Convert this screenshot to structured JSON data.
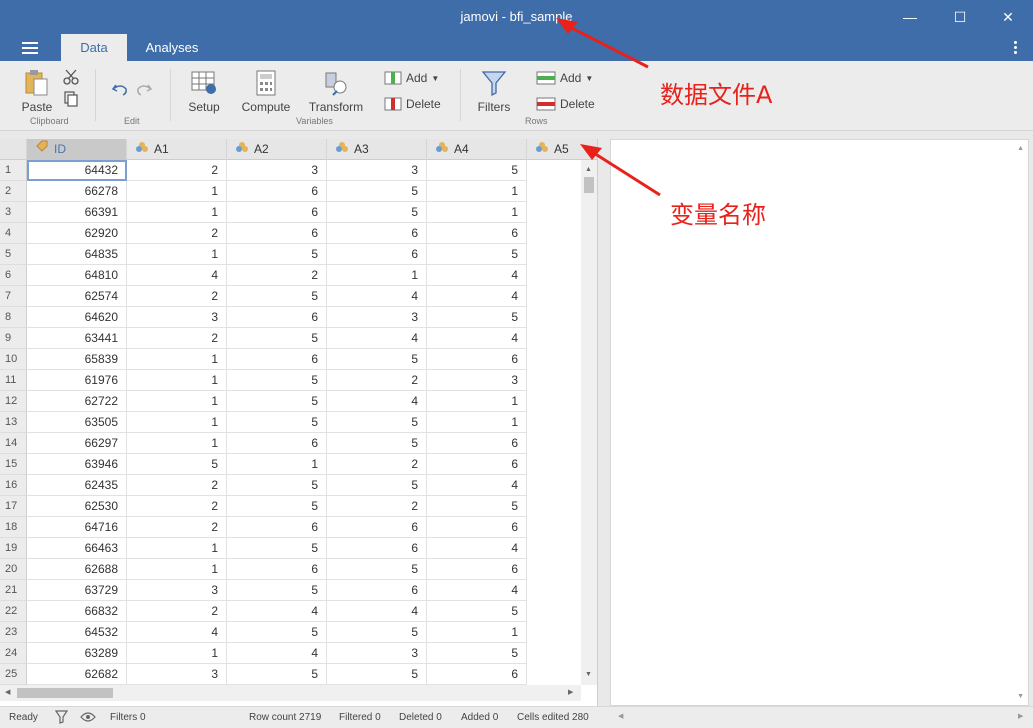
{
  "window": {
    "title": "jamovi - bfi_sample",
    "minimize": "—",
    "maximize": "☐",
    "close": "✕"
  },
  "tabs": {
    "data": "Data",
    "analyses": "Analyses"
  },
  "ribbon": {
    "clipboard": {
      "paste": "Paste",
      "group": "Clipboard"
    },
    "edit": {
      "group": "Edit"
    },
    "variables": {
      "setup": "Setup",
      "compute": "Compute",
      "transform": "Transform",
      "add": "Add",
      "delete": "Delete",
      "group": "Variables"
    },
    "rows": {
      "filters": "Filters",
      "add": "Add",
      "delete": "Delete",
      "group": "Rows"
    }
  },
  "columns": [
    "ID",
    "A1",
    "A2",
    "A3",
    "A4",
    "A5"
  ],
  "rows": [
    [
      1,
      64432,
      2,
      3,
      3,
      5
    ],
    [
      2,
      66278,
      1,
      6,
      5,
      1
    ],
    [
      3,
      66391,
      1,
      6,
      5,
      1
    ],
    [
      4,
      62920,
      2,
      6,
      6,
      6
    ],
    [
      5,
      64835,
      1,
      5,
      6,
      5
    ],
    [
      6,
      64810,
      4,
      2,
      1,
      4
    ],
    [
      7,
      62574,
      2,
      5,
      4,
      4
    ],
    [
      8,
      64620,
      3,
      6,
      3,
      5
    ],
    [
      9,
      63441,
      2,
      5,
      4,
      4
    ],
    [
      10,
      65839,
      1,
      6,
      5,
      6
    ],
    [
      11,
      61976,
      1,
      5,
      2,
      3
    ],
    [
      12,
      62722,
      1,
      5,
      4,
      1
    ],
    [
      13,
      63505,
      1,
      5,
      5,
      1
    ],
    [
      14,
      66297,
      1,
      6,
      5,
      6
    ],
    [
      15,
      63946,
      5,
      1,
      2,
      6
    ],
    [
      16,
      62435,
      2,
      5,
      5,
      4
    ],
    [
      17,
      62530,
      2,
      5,
      2,
      5
    ],
    [
      18,
      64716,
      2,
      6,
      6,
      6
    ],
    [
      19,
      66463,
      1,
      5,
      6,
      4
    ],
    [
      20,
      62688,
      1,
      6,
      5,
      6
    ],
    [
      21,
      63729,
      3,
      5,
      6,
      4
    ],
    [
      22,
      66832,
      2,
      4,
      4,
      5
    ],
    [
      23,
      64532,
      4,
      5,
      5,
      1
    ],
    [
      24,
      63289,
      1,
      4,
      3,
      5
    ],
    [
      25,
      62682,
      3,
      5,
      5,
      6
    ]
  ],
  "status": {
    "ready": "Ready",
    "filters": "Filters 0",
    "row_count": "Row count 2719",
    "filtered": "Filtered 0",
    "deleted": "Deleted 0",
    "added": "Added 0",
    "cells_edited": "Cells edited 280"
  },
  "annotations": {
    "data_file": "数据文件A",
    "variable_names": "变量名称"
  },
  "colors": {
    "accent": "#3e6da9",
    "annotation": "#e8221a"
  }
}
